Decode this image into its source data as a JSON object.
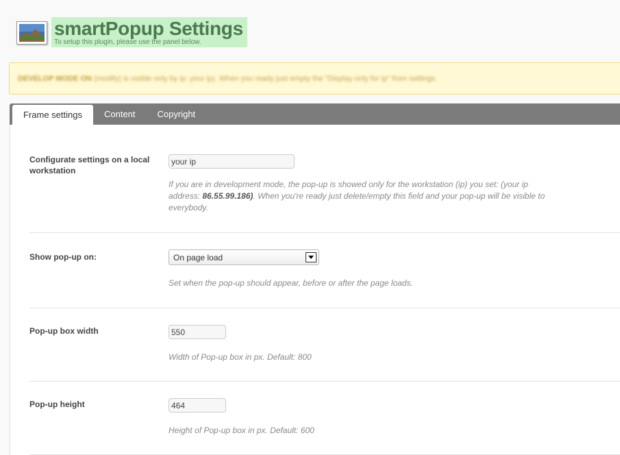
{
  "header": {
    "title": "smartPopup Settings",
    "subtitle": "To setup this plugin, please use the panel below."
  },
  "notice": {
    "bold": "DEVELOP MODE ON",
    "text": " (modify) is visible only by ip: your ip). When you ready just empty the \"Display only for ip\" from settings."
  },
  "tabs": [
    {
      "label": "Frame settings",
      "active": true
    },
    {
      "label": "Content",
      "active": false
    },
    {
      "label": "Copyright",
      "active": false
    }
  ],
  "settings": {
    "workstation": {
      "label": "Configurate settings on a local workstation",
      "value": "your ip",
      "help_1": "If you are in development mode, the pop-up is showed only for the workstation (ip) you set: (your ip address: ",
      "help_ip": "86.55.99.186)",
      "help_2": ". When you're ready just delete/empty this field and your pop-up will be visible to everybody."
    },
    "show_on": {
      "label": "Show pop-up on:",
      "value": "On page load",
      "help": "Set when the pop-up should appear, before or after the page loads."
    },
    "width": {
      "label": "Pop-up box width",
      "value": "550",
      "help": "Width of Pop-up box in px. Default: 800"
    },
    "height": {
      "label": "Pop-up height",
      "value": "464",
      "help": "Height of Pop-up box in px. Default: 600"
    }
  },
  "colors": {
    "title_highlight": "#c8f0c9",
    "title_text": "#4a7a4e",
    "notice_bg": "#fff9d6",
    "tabbar_bg": "#7b7b7b"
  },
  "icons": {
    "plugin": "landscape-picture-icon",
    "select_arrow": "caret-down-icon"
  }
}
